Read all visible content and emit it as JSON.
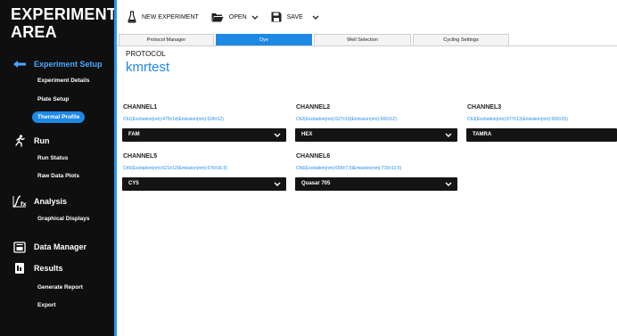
{
  "sidebar": {
    "title": "EXPERIMENT AREA",
    "sections": [
      {
        "label": "Experiment Setup",
        "icon": "setup-icon",
        "items": [
          "Experiment Details",
          "Plate Setup",
          "Thermal Profile"
        ],
        "selected": "Thermal Profile"
      },
      {
        "label": "Run",
        "icon": "run-icon",
        "items": [
          "Run Status",
          "Raw Data Plots"
        ]
      },
      {
        "label": "Analysis",
        "icon": "analysis-icon",
        "items": [
          "Graphical Displays"
        ]
      },
      {
        "label": "Data Manager",
        "icon": "data-manager-icon",
        "items": []
      },
      {
        "label": "Results",
        "icon": "results-icon",
        "items": [
          "Generate Report",
          "Export"
        ]
      }
    ]
  },
  "toolbar": {
    "new_label": "NEW EXPERIMENT",
    "open_label": "OPEN",
    "save_label": "SAVE"
  },
  "tabs": [
    {
      "label": "Protocol Manager",
      "active": false
    },
    {
      "label": "Dye",
      "active": true
    },
    {
      "label": "Well Selection",
      "active": false
    },
    {
      "label": "Cycling Settings",
      "active": false
    }
  ],
  "protocol": {
    "label": "PROTOCOL",
    "name": "kmrtest"
  },
  "channels": [
    {
      "title": "CHANNEL1",
      "spec": "Ch1(Excitation(nm):475±14)Emission(nm):524±12)",
      "dye": "FAM"
    },
    {
      "title": "CHANNEL2",
      "spec": "Ch2(Excitation(nm):527±10)Emission(nm):565±12)",
      "dye": "HEX"
    },
    {
      "title": "CHANNEL3",
      "spec": "Ch3(Excitation(nm):577±13)Emission(nm):593±15)",
      "dye": "TAMRA"
    },
    {
      "title": "CHANNEL5",
      "spec": "Ch5(Excitation(nm):621±12)Emission(nm):676±16.5)",
      "dye": "CY5"
    },
    {
      "title": "CHANNEL6",
      "spec": "Ch6(Excitation(nm):655±7.5)Emission(nm):715±12.5)",
      "dye": "Quasar 705"
    }
  ],
  "colors": {
    "accent": "#1e88e5",
    "sidebar": "#0f0f0f",
    "select": "#141414"
  }
}
